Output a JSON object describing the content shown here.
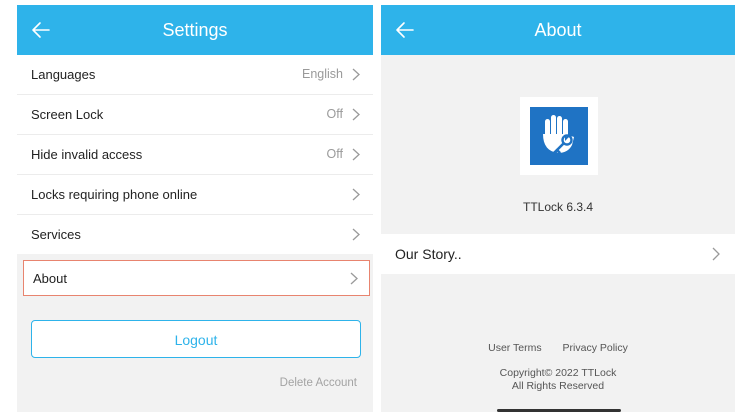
{
  "colors": {
    "header_blue": "#2eb3ea",
    "logo_blue": "#1f73c4",
    "highlight_border": "#e8846f"
  },
  "settings": {
    "title": "Settings",
    "back_icon": "arrow-left-icon",
    "rows": [
      {
        "label": "Languages",
        "value": "English"
      },
      {
        "label": "Screen Lock",
        "value": "Off"
      },
      {
        "label": "Hide invalid access",
        "value": "Off"
      },
      {
        "label": "Locks requiring phone online",
        "value": ""
      },
      {
        "label": "Services",
        "value": ""
      }
    ],
    "about_label": "About",
    "logout_label": "Logout",
    "delete_account_label": "Delete Account"
  },
  "about": {
    "title": "About",
    "back_icon": "arrow-left-icon",
    "logo_icon": "hand-key-logo",
    "version": "TTLock 6.3.4",
    "story_label": "Our Story..",
    "user_terms": "User Terms",
    "privacy_policy": "Privacy Policy",
    "copyright_line1": "Copyright© 2022 TTLock",
    "copyright_line2": "All Rights Reserved"
  }
}
